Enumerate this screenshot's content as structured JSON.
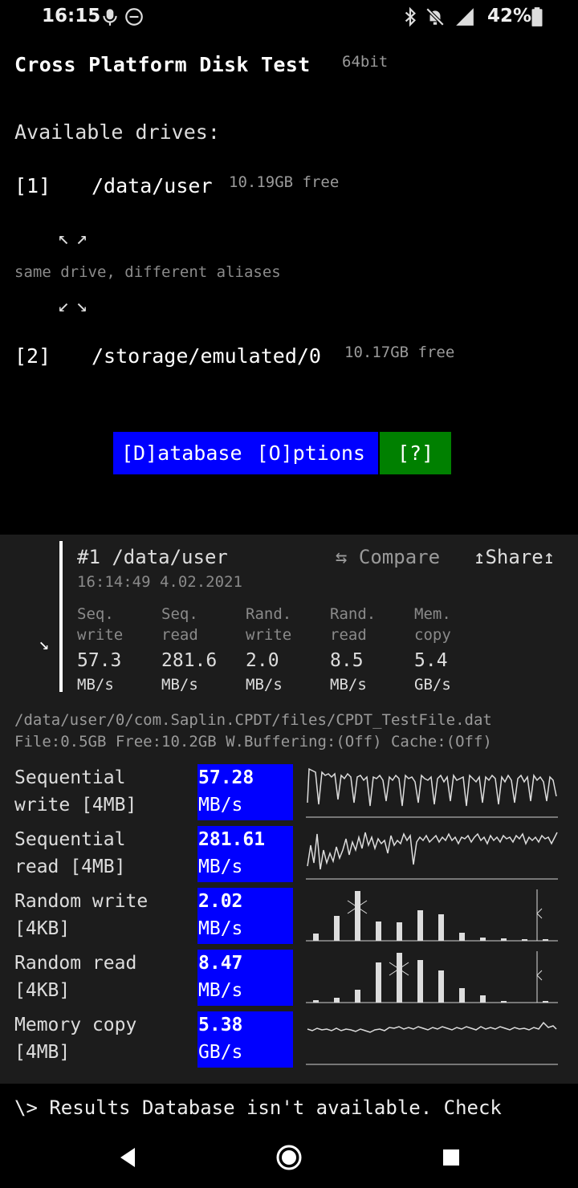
{
  "status_bar": {
    "time": "16:15",
    "battery": "42%",
    "icons": [
      "microphone-icon",
      "do-not-disturb-icon",
      "bluetooth-icon",
      "bell-off-icon",
      "signal-icon",
      "battery-icon"
    ]
  },
  "app": {
    "title": "Cross Platform Disk Test",
    "arch": "64bit"
  },
  "drives": {
    "heading": "Available drives:",
    "alias_note": "same drive, different aliases",
    "arrows_up": "↖↗",
    "arrows_down": "↙↘",
    "items": [
      {
        "num": "[1]",
        "path": "/data/user",
        "free": "10.19GB free"
      },
      {
        "num": "[2]",
        "path": "/storage/emulated/0",
        "free": "10.17GB free"
      }
    ]
  },
  "buttons": {
    "database": "[D]atabase",
    "options": "[O]ptions",
    "help": "[?]"
  },
  "result": {
    "title": "#1 /data/user",
    "timestamp": "16:14:49 4.02.2021",
    "compare": "⇆ Compare",
    "share": "↥Share↥",
    "collapse": "↘",
    "summary": [
      {
        "l1": "Seq.",
        "l2": "write",
        "value": "57.3",
        "unit": "MB/s"
      },
      {
        "l1": "Seq.",
        "l2": "read",
        "value": "281.6",
        "unit": "MB/s"
      },
      {
        "l1": "Rand.",
        "l2": "write",
        "value": "2.0",
        "unit": "MB/s"
      },
      {
        "l1": "Rand.",
        "l2": "read",
        "value": "8.5",
        "unit": "MB/s"
      },
      {
        "l1": "Mem.",
        "l2": "copy",
        "value": "5.4",
        "unit": "GB/s"
      }
    ],
    "file_path": "/data/user/0/com.Saplin.CPDT/files/CPDT_TestFile.dat",
    "file_info": "File:0.5GB Free:10.2GB W.Buffering:(Off) Cache:(Off)",
    "tests": [
      {
        "n1": "Sequential",
        "n2": "write [4MB]",
        "value": "57.28",
        "unit": "MB/s"
      },
      {
        "n1": "Sequential",
        "n2": "read [4MB]",
        "value": "281.61",
        "unit": "MB/s"
      },
      {
        "n1": "Random write",
        "n2": "[4KB]",
        "value": "2.02",
        "unit": "MB/s"
      },
      {
        "n1": "Random read",
        "n2": "[4KB]",
        "value": "8.47",
        "unit": "MB/s"
      },
      {
        "n1": "Memory copy",
        "n2": "[4MB]",
        "value": "5.38",
        "unit": "GB/s"
      }
    ]
  },
  "console": "\\> Results Database isn't available. Check",
  "colors": {
    "button_blue": "#0000ff",
    "button_green": "#008000",
    "panel_bg": "#1c1c1c"
  }
}
